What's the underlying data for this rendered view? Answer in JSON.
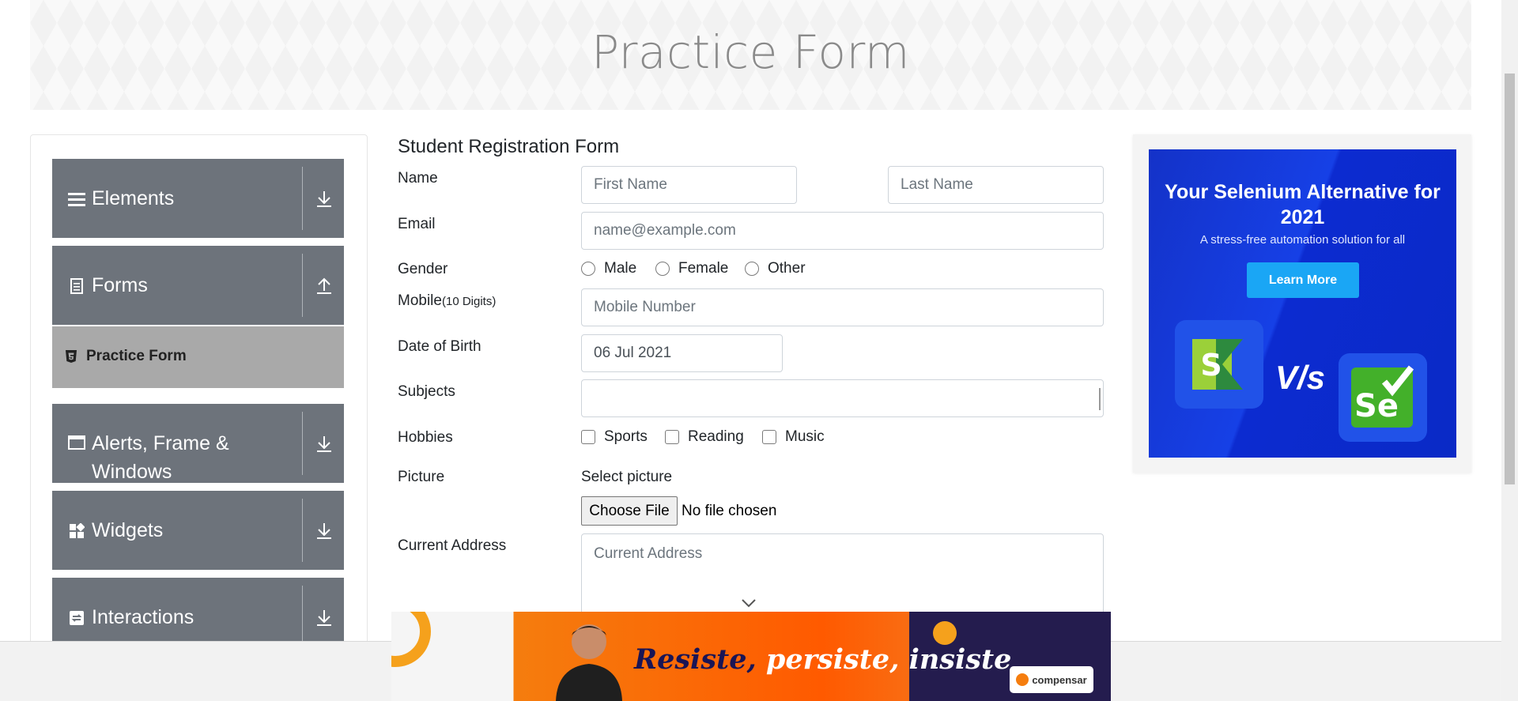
{
  "page": {
    "title": "Practice Form"
  },
  "sidebar": {
    "groups": [
      {
        "label": "Elements",
        "icon": "menu-icon",
        "arrow": "download-icon"
      },
      {
        "label": "Forms",
        "icon": "document-icon",
        "arrow": "upload-icon"
      },
      {
        "label": "Alerts, Frame & Windows",
        "icon": "window-icon",
        "arrow": "download-icon"
      },
      {
        "label": "Widgets",
        "icon": "widgets-icon",
        "arrow": "download-icon"
      },
      {
        "label": "Interactions",
        "icon": "interactions-icon",
        "arrow": "download-icon"
      }
    ],
    "active_item": {
      "label": "Practice Form",
      "icon": "html5-icon"
    }
  },
  "form": {
    "title": "Student Registration Form",
    "name_label": "Name",
    "first_name_placeholder": "First Name",
    "last_name_placeholder": "Last Name",
    "email_label": "Email",
    "email_placeholder": "name@example.com",
    "gender_label": "Gender",
    "gender_options": [
      "Male",
      "Female",
      "Other"
    ],
    "mobile_label": "Mobile",
    "mobile_hint": "(10 Digits)",
    "mobile_placeholder": "Mobile Number",
    "dob_label": "Date of Birth",
    "dob_value": "06 Jul 2021",
    "subjects_label": "Subjects",
    "hobbies_label": "Hobbies",
    "hobbies_options": [
      "Sports",
      "Reading",
      "Music"
    ],
    "picture_label": "Picture",
    "select_picture": "Select picture",
    "choose_file": "Choose File",
    "no_file": "No file chosen",
    "address_label": "Current Address",
    "address_placeholder": "Current Address"
  },
  "ad_side": {
    "headline": "Your Selenium Alternative for 2021",
    "subline": "A stress-free automation solution for all",
    "button": "Learn More",
    "vs": "V/s"
  },
  "ad_bottom": {
    "slogan_first": "Resiste,",
    "slogan_rest": "persiste, insiste",
    "brand": "compensar"
  },
  "colors": {
    "sidebar_group": "#6d737b",
    "active_item": "#a9a9a9",
    "ad_blue": "#1640e6",
    "ad_button": "#1aa6f5",
    "ad_orange": "#ff5a00"
  }
}
